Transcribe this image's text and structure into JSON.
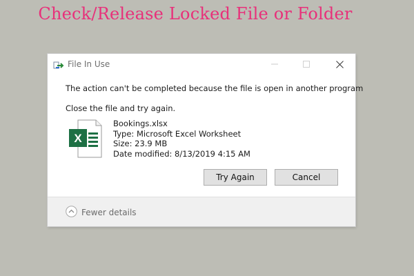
{
  "banner": {
    "title": "Check/Release Locked File or Folder",
    "color": "#e8307a"
  },
  "dialog": {
    "title": "File In Use",
    "app_icon": "file-in-use-icon",
    "window_buttons": {
      "minimize": "minimize-icon",
      "maximize": "maximize-icon",
      "close": "close-icon"
    },
    "message": "The action can't be completed because the file is open in another program",
    "instruction": "Close the file and try again.",
    "file": {
      "icon": "excel-file-icon",
      "name": "Bookings.xlsx",
      "type": "Type: Microsoft Excel Worksheet",
      "size": "Size: 23.9 MB",
      "date_modified": "Date modified: 8/13/2019 4:15 AM"
    },
    "buttons": {
      "try_again": "Try Again",
      "cancel": "Cancel"
    },
    "footer": {
      "toggle_label": "Fewer details",
      "toggle_icon": "chevron-up-circle-icon"
    }
  },
  "colors": {
    "background": "#bdbdb5",
    "excel_green": "#1d7044"
  }
}
